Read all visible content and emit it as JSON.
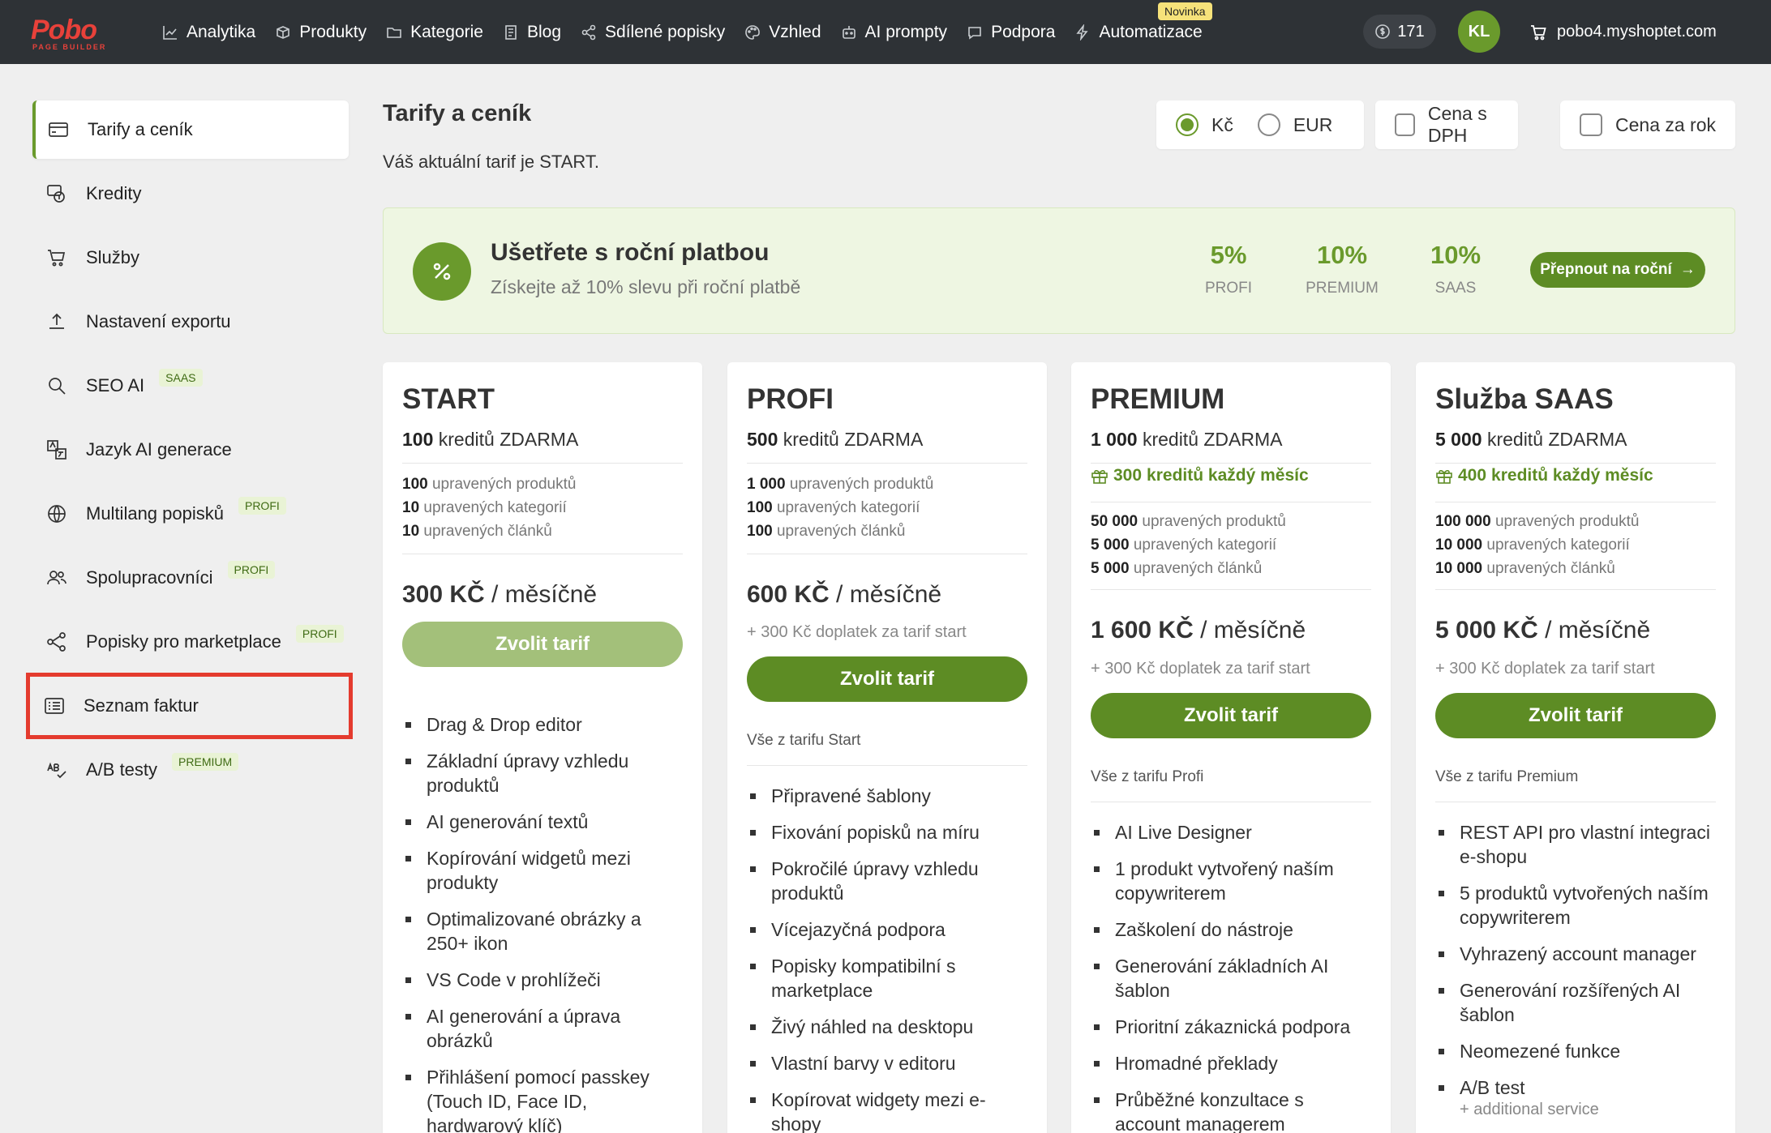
{
  "topbar": {
    "logo_text": "Pobo",
    "logo_sub": "PAGE BUILDER",
    "nav": [
      {
        "label": "Analytika",
        "icon": "chart-icon"
      },
      {
        "label": "Produkty",
        "icon": "box-icon"
      },
      {
        "label": "Kategorie",
        "icon": "folder-icon"
      },
      {
        "label": "Blog",
        "icon": "document-icon"
      },
      {
        "label": "Sdílené popisky",
        "icon": "share-icon"
      },
      {
        "label": "Vzhled",
        "icon": "palette-icon"
      },
      {
        "label": "AI prompty",
        "icon": "robot-icon"
      },
      {
        "label": "Podpora",
        "icon": "chat-icon"
      },
      {
        "label": "Automatizace",
        "icon": "lightning-icon"
      }
    ],
    "new_badge": "Novinka",
    "credits": "171",
    "avatar_initials": "KL",
    "shop_domain": "pobo4.myshoptet.com"
  },
  "sidebar": {
    "items": [
      {
        "label": "Tarify a ceník",
        "icon": "card-icon",
        "tag": ""
      },
      {
        "label": "Kredity",
        "icon": "coins-icon",
        "tag": ""
      },
      {
        "label": "Služby",
        "icon": "cart-icon",
        "tag": ""
      },
      {
        "label": "Nastavení exportu",
        "icon": "upload-icon",
        "tag": ""
      },
      {
        "label": "SEO AI",
        "icon": "search-icon",
        "tag": "SAAS"
      },
      {
        "label": "Jazyk AI generace",
        "icon": "translate-icon",
        "tag": ""
      },
      {
        "label": "Multilang popisků",
        "icon": "globe-icon",
        "tag": "PROFI"
      },
      {
        "label": "Spolupracovníci",
        "icon": "users-icon",
        "tag": "PROFI"
      },
      {
        "label": "Popisky pro marketplace",
        "icon": "share-icon",
        "tag": "PROFI"
      },
      {
        "label": "Seznam faktur",
        "icon": "list-icon",
        "tag": ""
      },
      {
        "label": "A/B testy",
        "icon": "spellcheck-icon",
        "tag": "PREMIUM"
      }
    ]
  },
  "main": {
    "title": "Tarify a ceník",
    "subtitle": "Váš aktuální tarif je START.",
    "currency_czk": "Kč",
    "currency_eur": "EUR",
    "vat_label": "Cena s DPH",
    "yearly_label": "Cena za rok"
  },
  "banner": {
    "title": "Ušetřete s roční platbou",
    "subtitle": "Získejte až 10% slevu při roční platbě",
    "discounts": [
      {
        "value": "5%",
        "label": "PROFI"
      },
      {
        "value": "10%",
        "label": "PREMIUM"
      },
      {
        "value": "10%",
        "label": "SAAS"
      }
    ],
    "button": "Přepnout na roční"
  },
  "plans": [
    {
      "name": "START",
      "credits_num": "100",
      "credits_text": " kreditů ZDARMA",
      "bonus_num": "",
      "bonus_text": "",
      "stats": [
        {
          "num": "100",
          "text": " upravených produktů"
        },
        {
          "num": "10",
          "text": " upravených kategorií"
        },
        {
          "num": "10",
          "text": " upravených článků"
        }
      ],
      "price": "300 KČ",
      "period": " / měsíčně",
      "extra": "",
      "button": "Zvolit tarif",
      "includes": "",
      "features": [
        {
          "text": "Drag & Drop editor",
          "note": ""
        },
        {
          "text": "Základní úpravy vzhledu produktů",
          "note": ""
        },
        {
          "text": "AI generování textů",
          "note": ""
        },
        {
          "text": "Kopírování widgetů mezi produkty",
          "note": ""
        },
        {
          "text": "Optimalizované obrázky a 250+ ikon",
          "note": ""
        },
        {
          "text": "VS Code v prohlížeči",
          "note": ""
        },
        {
          "text": "AI generování a úprava obrázků",
          "note": ""
        },
        {
          "text": "Přihlášení pomocí passkey (Touch ID, Face ID, hardwarový klíč)",
          "note": ""
        }
      ]
    },
    {
      "name": "PROFI",
      "credits_num": "500",
      "credits_text": " kreditů ZDARMA",
      "bonus_num": "",
      "bonus_text": "",
      "stats": [
        {
          "num": "1 000",
          "text": " upravených produktů"
        },
        {
          "num": "100",
          "text": " upravených kategorií"
        },
        {
          "num": "100",
          "text": " upravených článků"
        }
      ],
      "price": "600 KČ",
      "period": " / měsíčně",
      "extra": "+ 300 Kč doplatek za tarif start",
      "button": "Zvolit tarif",
      "includes": "Vše z tarifu Start",
      "features": [
        {
          "text": "Připravené šablony",
          "note": ""
        },
        {
          "text": "Fixování popisků na míru",
          "note": ""
        },
        {
          "text": "Pokročilé úpravy vzhledu produktů",
          "note": ""
        },
        {
          "text": "Vícejazyčná podpora",
          "note": ""
        },
        {
          "text": "Popisky kompatibilní s marketplace",
          "note": ""
        },
        {
          "text": "Živý náhled na desktopu",
          "note": ""
        },
        {
          "text": "Vlastní barvy v editoru",
          "note": ""
        },
        {
          "text": "Kopírovat widgety mezi e-shopy",
          "note": ""
        }
      ]
    },
    {
      "name": "PREMIUM",
      "credits_num": "1 000",
      "credits_text": " kreditů ZDARMA",
      "bonus_num": "300",
      "bonus_text": " kreditů každý měsíc",
      "stats": [
        {
          "num": "50 000",
          "text": " upravených produktů"
        },
        {
          "num": "5 000",
          "text": " upravených kategorií"
        },
        {
          "num": "5 000",
          "text": " upravených článků"
        }
      ],
      "price": "1 600 KČ",
      "period": " / měsíčně",
      "extra": "+ 300 Kč doplatek za tarif start",
      "button": "Zvolit tarif",
      "includes": "Vše z tarifu Profi",
      "features": [
        {
          "text": "AI Live Designer",
          "note": ""
        },
        {
          "text": "1 produkt vytvořený naším copywriterem",
          "note": ""
        },
        {
          "text": "Zaškolení do nástroje",
          "note": ""
        },
        {
          "text": "Generování základních AI šablon",
          "note": ""
        },
        {
          "text": "Prioritní zákaznická podpora",
          "note": ""
        },
        {
          "text": "Hromadné překlady",
          "note": ""
        },
        {
          "text": "Průběžné konzultace s account managerem",
          "note": ""
        }
      ]
    },
    {
      "name": "Služba SAAS",
      "credits_num": "5 000",
      "credits_text": " kreditů ZDARMA",
      "bonus_num": "400",
      "bonus_text": " kreditů každý měsíc",
      "stats": [
        {
          "num": "100 000",
          "text": " upravených produktů"
        },
        {
          "num": "10 000",
          "text": " upravených kategorií"
        },
        {
          "num": "10 000",
          "text": " upravených článků"
        }
      ],
      "price": "5 000 KČ",
      "period": " / měsíčně",
      "extra": "+ 300 Kč doplatek za tarif start",
      "button": "Zvolit tarif",
      "includes": "Vše z tarifu Premium",
      "features": [
        {
          "text": "REST API pro vlastní integraci e-shopu",
          "note": ""
        },
        {
          "text": "5 produktů vytvořených naším copywriterem",
          "note": ""
        },
        {
          "text": "Vyhrazený account manager",
          "note": ""
        },
        {
          "text": "Generování rozšířených AI šablon",
          "note": ""
        },
        {
          "text": "Neomezené funkce",
          "note": ""
        },
        {
          "text": "A/B test",
          "note": "+ additional service"
        }
      ]
    }
  ]
}
